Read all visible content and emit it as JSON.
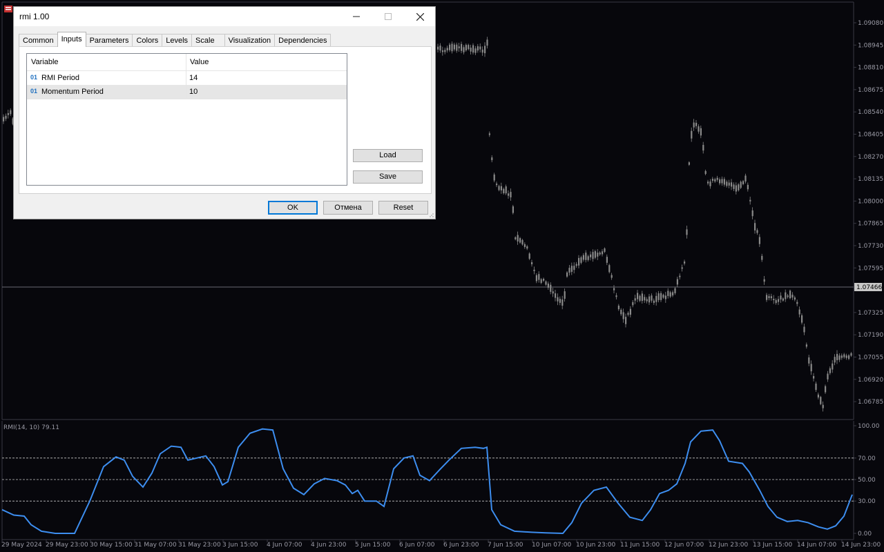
{
  "dialog": {
    "title": "rmi 1.00",
    "tabs": [
      "Common",
      "Inputs",
      "Parameters",
      "Colors",
      "Levels",
      "Scale",
      "Visualization",
      "Dependencies"
    ],
    "active_tab": "Inputs",
    "table": {
      "headers": [
        "Variable",
        "Value"
      ],
      "rows": [
        {
          "type_badge": "01",
          "variable": "RMI Period",
          "value": "14"
        },
        {
          "type_badge": "01",
          "variable": "Momentum Period",
          "value": "10"
        }
      ]
    },
    "load_label": "Load",
    "save_label": "Save",
    "ok_label": "OK",
    "cancel_label": "Отмена",
    "reset_label": "Reset"
  },
  "chart": {
    "price_axis": [
      "1.09080",
      "1.08945",
      "1.08810",
      "1.08675",
      "1.08540",
      "1.08405",
      "1.08270",
      "1.08135",
      "1.08000",
      "1.07865",
      "1.07730",
      "1.07595",
      "1.07325",
      "1.07190",
      "1.07055",
      "1.06920",
      "1.06785"
    ],
    "current_price": "1.07466",
    "indicator_label": "RMI(14, 10) 79.11",
    "indicator_axis": [
      "100.00",
      "70.00",
      "50.00",
      "30.00",
      "0.00"
    ],
    "levels": [
      70,
      50,
      30
    ],
    "time_axis": [
      "29 May 2024",
      "29 May 23:00",
      "30 May 15:00",
      "31 May 07:00",
      "31 May 23:00",
      "3 Jun 15:00",
      "4 Jun 07:00",
      "4 Jun 23:00",
      "5 Jun 15:00",
      "6 Jun 07:00",
      "6 Jun 23:00",
      "7 Jun 15:00",
      "10 Jun 07:00",
      "10 Jun 23:00",
      "11 Jun 15:00",
      "12 Jun 07:00",
      "12 Jun 23:00",
      "13 Jun 15:00",
      "14 Jun 07:00",
      "14 Jun 23:00"
    ],
    "colors": {
      "background": "#07070c",
      "candles": "#8a8a8a",
      "grid_text": "#9b9ba6",
      "rmi_line": "#3d8ef0",
      "level_line": "#c8c8c8",
      "separator": "#3a3a44"
    }
  }
}
